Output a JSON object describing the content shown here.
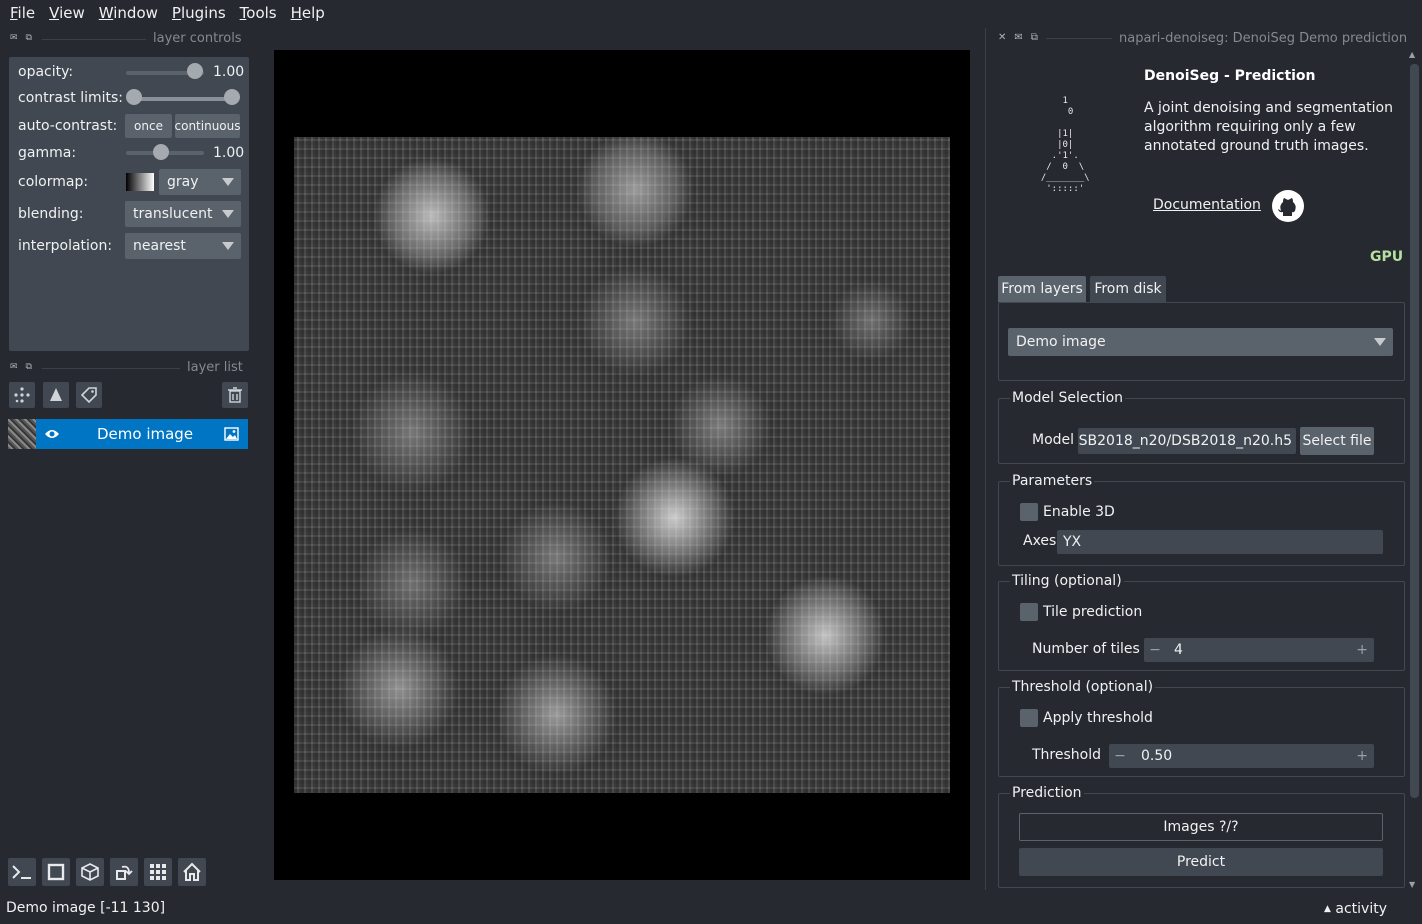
{
  "menubar": {
    "items": [
      {
        "first": "F",
        "rest": "ile"
      },
      {
        "first": "V",
        "rest": "iew"
      },
      {
        "first": "W",
        "rest": "indow"
      },
      {
        "first": "P",
        "rest": "lugins"
      },
      {
        "first": "T",
        "rest": "ools"
      },
      {
        "first": "H",
        "rest": "elp"
      }
    ]
  },
  "layer_controls": {
    "title": "layer controls",
    "opacity_label": "opacity:",
    "opacity_value": "1.00",
    "opacity_level": 1.0,
    "contrast_label": "contrast limits:",
    "contrast_range": [
      0.0,
      1.0
    ],
    "auto_contrast_label": "auto-contrast:",
    "once_label": "once",
    "continuous_label": "continuous",
    "gamma_label": "gamma:",
    "gamma_value": "1.00",
    "colormap_label": "colormap:",
    "colormap_value": "gray",
    "blending_label": "blending:",
    "blending_value": "translucent",
    "interpolation_label": "interpolation:",
    "interpolation_value": "nearest"
  },
  "layer_list": {
    "title": "layer list",
    "layers": [
      {
        "name": "Demo image",
        "visible": true
      }
    ]
  },
  "plugin": {
    "dock_title": "napari-denoiseg: DenoiSeg Demo prediction",
    "title": "DenoiSeg - Prediction",
    "description": "A joint denoising and segmentation algorithm requiring only a few annotated ground truth images.",
    "documentation_link": "Documentation",
    "device": "GPU",
    "device_color": "#b5e0a0",
    "tabs": [
      "From layers",
      "From disk"
    ],
    "active_tab": "From layers",
    "layer_select": "Demo image",
    "model_section": {
      "title": "Model Selection",
      "model_label": "Model",
      "model_path": "SB2018_n20/DSB2018_n20.h5",
      "select_file": "Select file"
    },
    "parameters": {
      "title": "Parameters",
      "enable_3d_label": "Enable 3D",
      "axes_label": "Axes",
      "axes_value": "YX"
    },
    "tiling": {
      "title": "Tiling (optional)",
      "tile_label": "Tile prediction",
      "tiles_label": "Number of tiles",
      "tiles_value": "4"
    },
    "threshold": {
      "title": "Threshold (optional)",
      "apply_label": "Apply threshold",
      "threshold_label": "Threshold",
      "threshold_value": "0.50"
    },
    "prediction": {
      "title": "Prediction",
      "progress_label": "Images ?/?",
      "predict_label": "Predict"
    }
  },
  "statusbar": {
    "text": "Demo image [-11 130]",
    "activity": "activity"
  },
  "colors": {
    "background": "#262930",
    "panel": "#414851",
    "control": "#5a626c",
    "selected": "#0075c4"
  }
}
